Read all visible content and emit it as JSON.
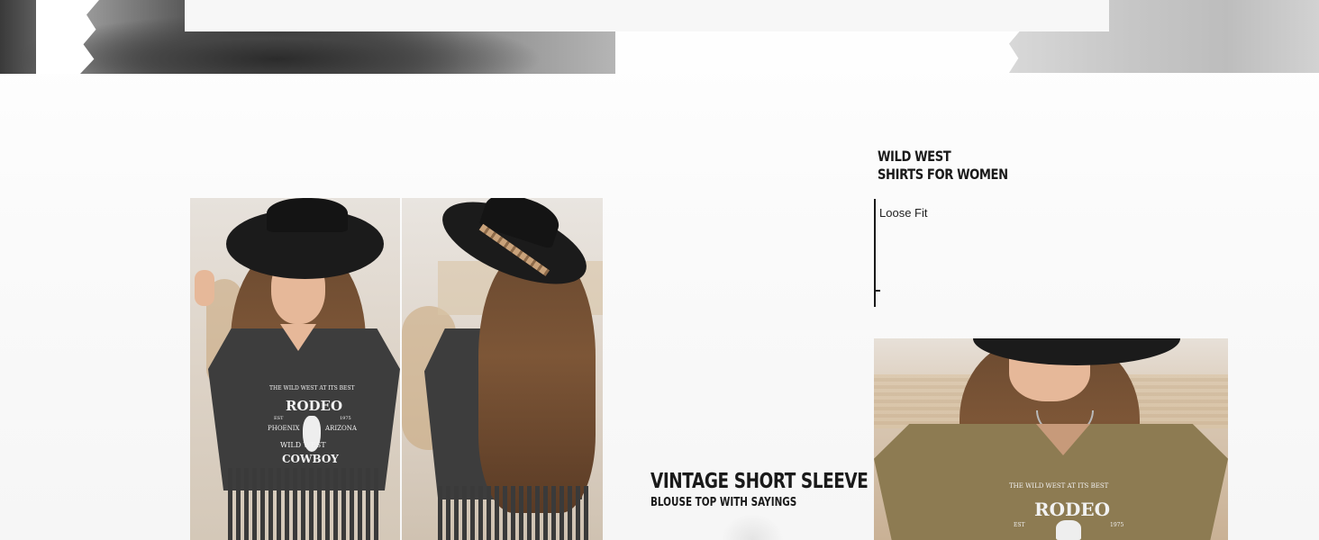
{
  "banner": {
    "left_image": "rodeo-rider-grayscale-photo",
    "right_image": "grayscale-landscape-photo"
  },
  "headings": {
    "right_line1": "WILD WEST",
    "right_line2": "SHIRTS FOR WOMEN",
    "mid_line1": "VINTAGE SHORT SLEEVE",
    "mid_line2": "BLOUSE TOP WITH SAYINGS"
  },
  "features": {
    "fit_label": "Loose Fit"
  },
  "products": {
    "front": {
      "image": "woman-black-hat-charcoal-fringe-tee-front",
      "print": {
        "arc": "THE WILD WEST AT ITS BEST",
        "title": "RODEO",
        "est_left": "EST",
        "est_right": "1975",
        "city": "PHOENIX",
        "state": "ARIZONA",
        "line2": "WILD WEST",
        "line3": "COWBOY"
      }
    },
    "back": {
      "image": "woman-black-hat-charcoal-fringe-tee-back"
    },
    "olive": {
      "image": "woman-black-hat-olive-tee",
      "print": {
        "arc": "THE WILD WEST AT ITS BEST",
        "title": "RODEO",
        "est_left": "EST",
        "est_right": "1975"
      }
    }
  },
  "colors": {
    "text_dark": "#1a1a1a",
    "charcoal_tee": "#3d3d3d",
    "olive_tee": "#8d7b52",
    "hat_black": "#1b1b1b"
  }
}
